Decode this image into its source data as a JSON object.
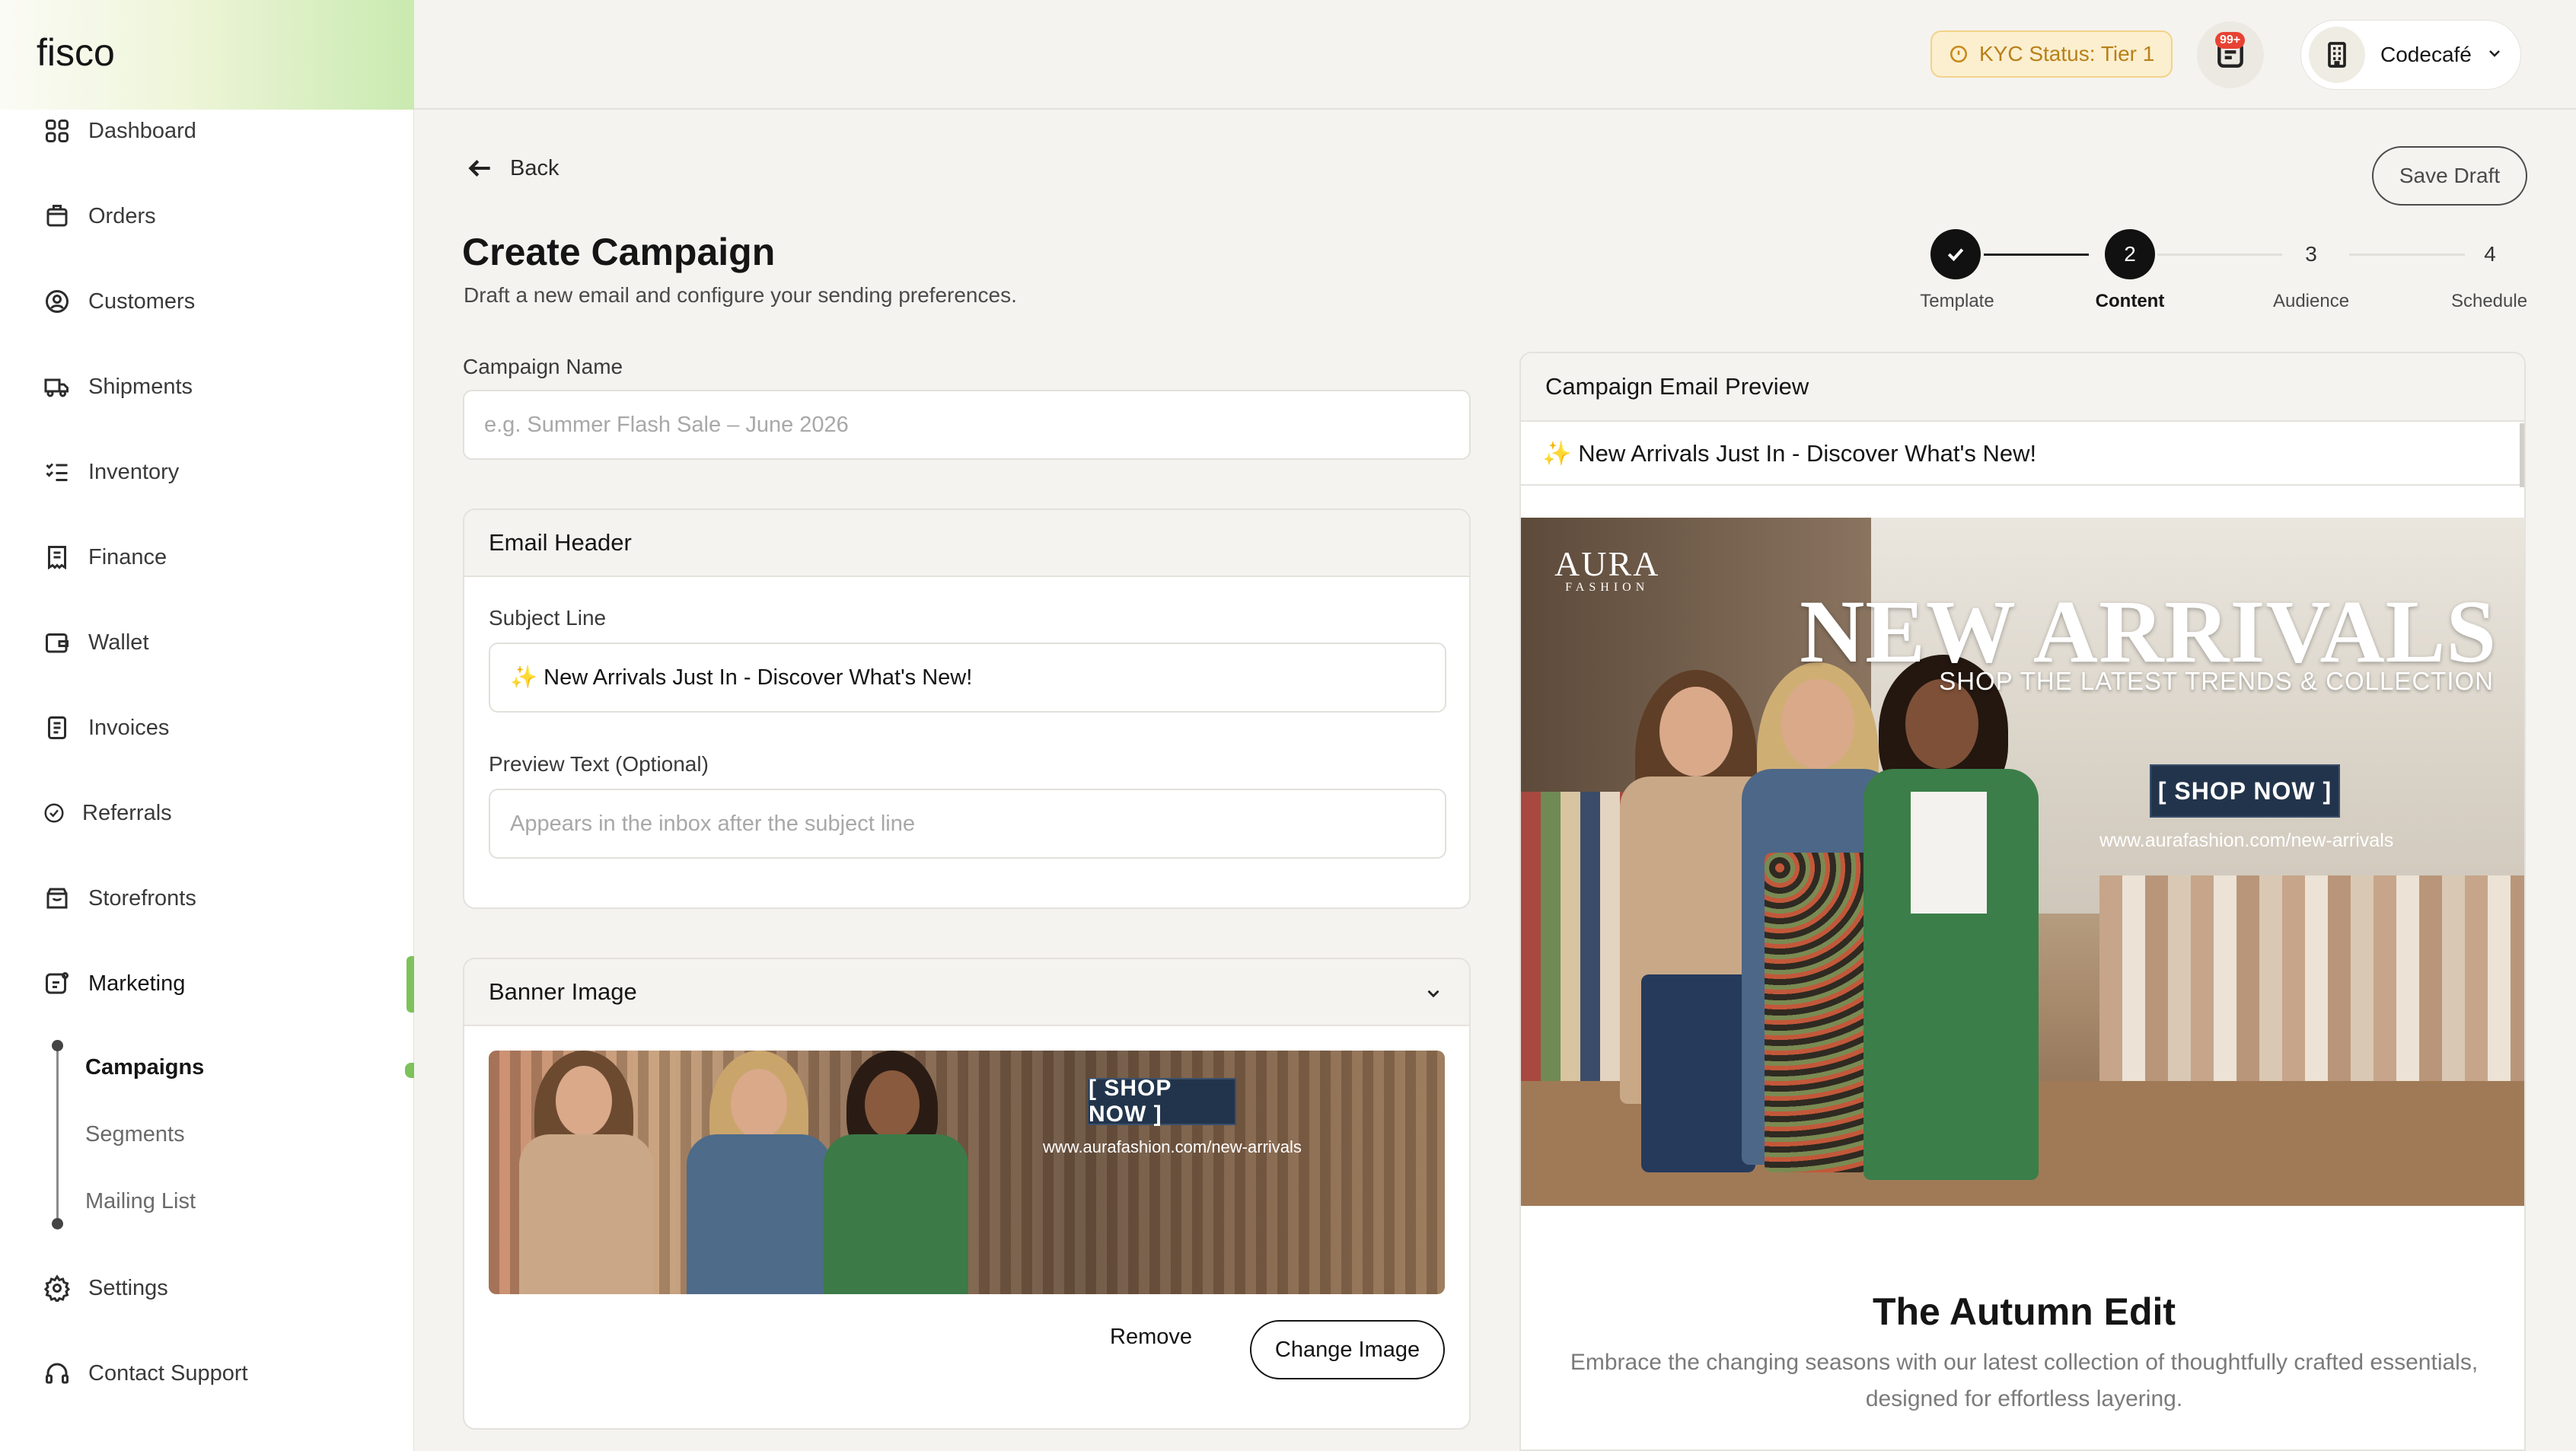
{
  "app": {
    "logo": "fisco"
  },
  "sidebar": {
    "items": [
      {
        "label": "Dashboard",
        "icon": "dashboard-icon"
      },
      {
        "label": "Orders",
        "icon": "orders-icon"
      },
      {
        "label": "Customers",
        "icon": "customers-icon"
      },
      {
        "label": "Shipments",
        "icon": "truck-icon"
      },
      {
        "label": "Inventory",
        "icon": "checklist-icon"
      },
      {
        "label": "Finance",
        "icon": "receipt-icon"
      },
      {
        "label": "Wallet",
        "icon": "wallet-icon"
      },
      {
        "label": "Invoices",
        "icon": "invoice-icon"
      },
      {
        "label": "Referrals",
        "icon": "check-circle-icon"
      },
      {
        "label": "Storefronts",
        "icon": "storefront-icon"
      },
      {
        "label": "Marketing",
        "icon": "marketing-icon",
        "active": true
      },
      {
        "label": "Settings",
        "icon": "gear-icon"
      },
      {
        "label": "Contact Support",
        "icon": "headset-icon"
      }
    ],
    "marketing_sub": [
      {
        "label": "Campaigns",
        "active": true
      },
      {
        "label": "Segments"
      },
      {
        "label": "Mailing List"
      }
    ]
  },
  "topbar": {
    "kyc": "KYC Status: Tier 1",
    "notif_badge": "99+",
    "account_name": "Codecafé"
  },
  "page": {
    "back": "Back",
    "save_draft": "Save Draft",
    "title": "Create Campaign",
    "subtitle": "Draft a new email and configure your sending preferences."
  },
  "stepper": {
    "steps": [
      {
        "label": "Template",
        "state": "done",
        "number": ""
      },
      {
        "label": "Content",
        "state": "current",
        "number": "2"
      },
      {
        "label": "Audience",
        "state": "todo",
        "number": "3"
      },
      {
        "label": "Schedule",
        "state": "todo",
        "number": "4"
      }
    ]
  },
  "form": {
    "campaign_name_label": "Campaign Name",
    "campaign_name_placeholder": "e.g. Summer Flash Sale – June 2026",
    "email_header_title": "Email Header",
    "subject_label": "Subject Line",
    "subject_value": "✨ New Arrivals Just In - Discover What's New!",
    "preview_label": "Preview Text (Optional)",
    "preview_placeholder": "Appears in the inbox after the subject line",
    "banner_title": "Banner Image",
    "remove": "Remove",
    "change_image": "Change Image"
  },
  "banner": {
    "shop_now": "[ SHOP NOW ]",
    "url": "www.aurafashion.com/new-arrivals",
    "brand": "AURA",
    "brand_sub": "FASHION",
    "headline": "NEW ARRIVALS",
    "tagline": "SHOP THE LATEST TRENDS & COLLECTION"
  },
  "preview": {
    "title": "Campaign Email Preview",
    "subject": "✨ New Arrivals Just In - Discover What's New!",
    "section_title": "The Autumn Edit",
    "section_body": "Embrace the changing seasons with our latest collection of thoughtfully crafted essentials, designed for effortless layering."
  },
  "colors": {
    "accent_green": "#7dc25a",
    "kyc_bg": "#fbefcf",
    "kyc_text": "#b9801a",
    "badge_red": "#e74233",
    "shop_now_bg": "#22344b"
  }
}
